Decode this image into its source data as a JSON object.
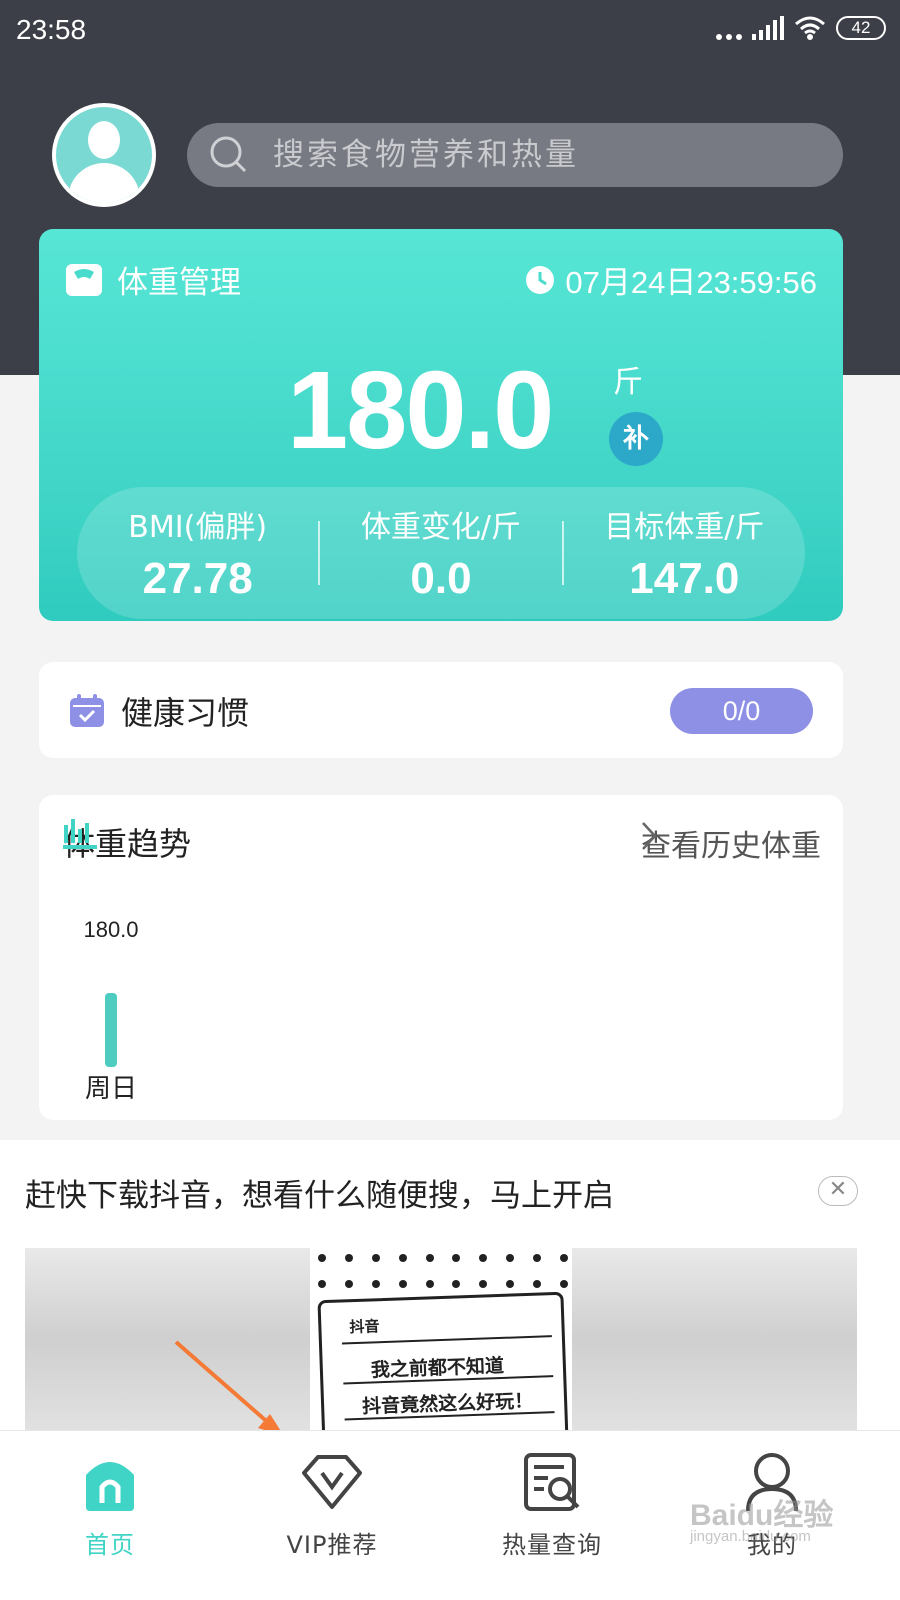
{
  "status": {
    "time": "23:58",
    "battery": "42"
  },
  "search": {
    "placeholder": "搜索食物营养和热量"
  },
  "weight_card": {
    "title": "体重管理",
    "datetime": "07月24日23:59:56",
    "weight": "180.0",
    "unit": "斤",
    "supplement_badge": "补",
    "stats": [
      {
        "label": "BMI(偏胖)",
        "value": "27.78"
      },
      {
        "label": "体重变化/斤",
        "value": "0.0"
      },
      {
        "label": "目标体重/斤",
        "value": "147.0"
      }
    ]
  },
  "habits": {
    "title": "健康习惯",
    "progress": "0/0"
  },
  "trend": {
    "title": "体重趋势",
    "more_link": "查看历史体重",
    "colors": {
      "bar": "#4dccbf"
    }
  },
  "chart_data": {
    "type": "bar",
    "categories": [
      "周日"
    ],
    "values": [
      180.0
    ],
    "data_labels": [
      "180.0"
    ]
  },
  "ad": {
    "text": "赶快下载抖音，想看什么随便搜，马上开启",
    "close_label": "✕",
    "image": {
      "brand": "抖音",
      "line1": "我之前都不知道",
      "line2": "抖音竟然这么好玩！"
    }
  },
  "nav": {
    "items": [
      {
        "label": "首页",
        "icon": "home-icon",
        "active": true
      },
      {
        "label": "VIP推荐",
        "icon": "vip-icon",
        "active": false
      },
      {
        "label": "热量查询",
        "icon": "calorie-search-icon",
        "active": false
      },
      {
        "label": "我的",
        "icon": "profile-icon",
        "active": false
      }
    ],
    "colors": {
      "active": "#3fd4c6",
      "inactive": "#444444"
    }
  },
  "watermark": {
    "logo": "Baidu经验",
    "url": "jingyan.baidu.com"
  },
  "colors": {
    "accent": "#3fd4c6",
    "header_bg": "#3d3f48",
    "habit_pill": "#8e90e6",
    "badge": "#2ca8c9",
    "arrow": "#f47a36"
  }
}
